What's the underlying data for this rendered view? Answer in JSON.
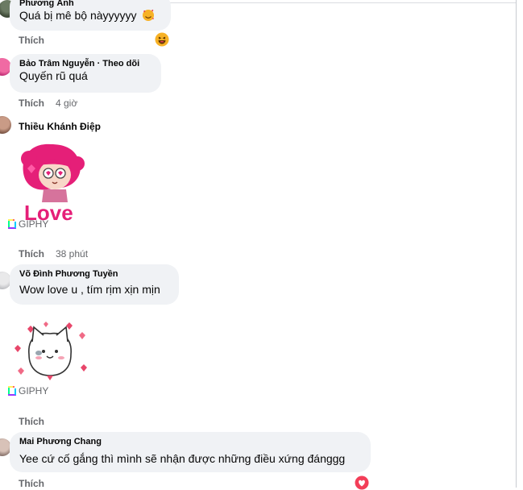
{
  "comments": [
    {
      "author": "Phương Ánh",
      "text": "Quá bị mê bộ nàyyyyyy",
      "like_label": "Thích",
      "time": "",
      "reaction": "haha"
    },
    {
      "author": "Bảo Trâm Nguyễn · Theo dõi",
      "text": "Quyến rũ quá",
      "like_label": "Thích",
      "time": "4 giờ"
    },
    {
      "author": "Thiều Khánh Điệp",
      "sticker": "love-girl",
      "sticker_text": "Love",
      "giphy_label": "GIPHY",
      "like_label": "Thích",
      "time": "38 phút"
    },
    {
      "author": "Võ Đình Phương Tuyền",
      "text": "Wow love u , tím rịm xịn mịn",
      "sticker": "cat-hearts",
      "giphy_label": "GIPHY",
      "like_label": "Thích"
    },
    {
      "author": "Mai Phương Chang",
      "text": "Yee cứ cố gắng thì mình sẽ nhận được những điều xứng đánggg",
      "like_label": "Thích",
      "reaction": "love"
    }
  ],
  "colors": {
    "bubble": "#f0f2f5",
    "muted": "#65676b",
    "love": "#f33e58",
    "haha": "#f7b125"
  }
}
